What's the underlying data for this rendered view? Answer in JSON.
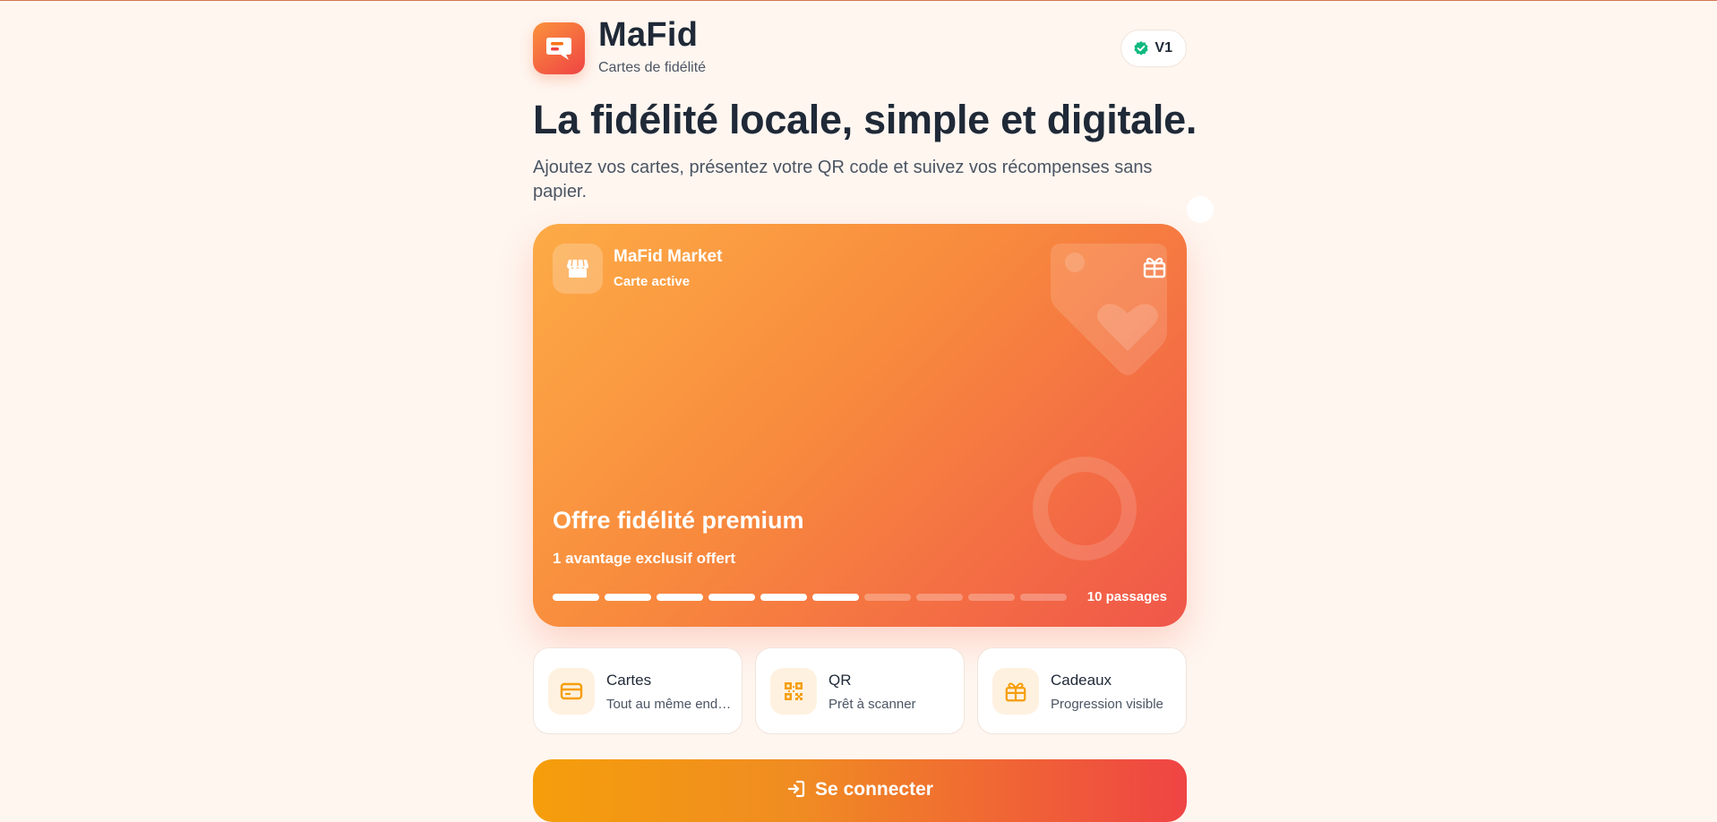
{
  "brand": {
    "name": "MaFid",
    "subtitle": "Cartes de fidélité",
    "logo_icon": "chat-card-icon",
    "accent_from": "#fb923c",
    "accent_to": "#ef4444"
  },
  "version_badge": {
    "label": "V1",
    "icon": "verified-check-icon",
    "icon_color": "#10b981"
  },
  "hero": {
    "headline": "La fidélité locale, simple et digitale.",
    "lead": "Ajoutez vos cartes, présentez votre QR code et suivez vos récompenses sans papier."
  },
  "card": {
    "store_name": "MaFid Market",
    "status": "Carte active",
    "store_icon": "store-icon",
    "gift_icon": "gift-icon",
    "offer_title": "Offre fidélité premium",
    "offer_sub": "1 avantage exclusif offert",
    "stamps_total": 10,
    "stamps_filled": 6,
    "passages_label": "10 passages",
    "gradient": [
      "#fdab46",
      "#f88a3d",
      "#f0564a"
    ]
  },
  "features": [
    {
      "title": "Cartes",
      "subtitle": "Tout au même endroit",
      "icon": "credit-card-icon"
    },
    {
      "title": "QR",
      "subtitle": "Prêt à scanner",
      "icon": "qr-code-icon"
    },
    {
      "title": "Cadeaux",
      "subtitle": "Progression visible",
      "icon": "gift-icon"
    }
  ],
  "cta": {
    "label": "Se connecter",
    "icon": "login-icon"
  }
}
